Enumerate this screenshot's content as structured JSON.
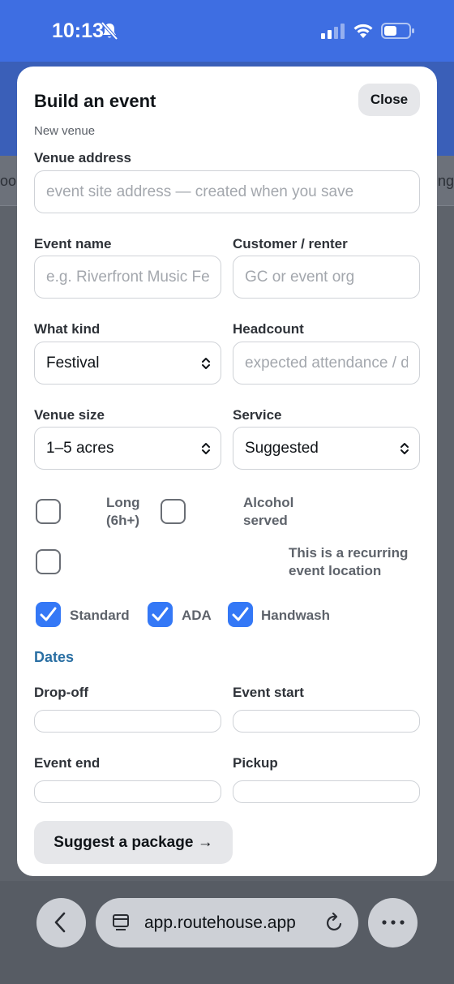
{
  "status_bar": {
    "time": "10:13"
  },
  "backdrop": {
    "tab_left": "oo",
    "tab_right": "ng"
  },
  "modal": {
    "title": "Build an event",
    "close_label": "Close",
    "subtitle": "New venue",
    "venue_address": {
      "label": "Venue address",
      "placeholder": "event site address — created when you save"
    },
    "event_name": {
      "label": "Event name",
      "placeholder": "e.g. Riverfront Music Festival"
    },
    "customer": {
      "label": "Customer / renter",
      "placeholder": "GC or event org"
    },
    "what_kind": {
      "label": "What kind",
      "value": "Festival"
    },
    "headcount": {
      "label": "Headcount",
      "placeholder": "expected attendance / day"
    },
    "venue_size": {
      "label": "Venue size",
      "value": "1–5 acres"
    },
    "service": {
      "label": "Service",
      "value": "Suggested"
    },
    "options": {
      "long_line1": "Long",
      "long_line2": "(6h+)",
      "alcohol_line1": "Alcohol",
      "alcohol_line2": "served",
      "recurring_line1": "This is a recurring",
      "recurring_line2": "event location",
      "long_checked": false,
      "alcohol_checked": false,
      "recurring_checked": false
    },
    "units": [
      {
        "label": "Standard",
        "checked": true
      },
      {
        "label": "ADA",
        "checked": true
      },
      {
        "label": "Handwash",
        "checked": true
      }
    ],
    "dates": {
      "title": "Dates",
      "dropoff_label": "Drop-off",
      "event_start_label": "Event start",
      "event_end_label": "Event end",
      "pickup_label": "Pickup"
    },
    "suggest_label": "Suggest a package →"
  },
  "browser": {
    "url": "app.routehouse.app"
  },
  "colors": {
    "accent": "#3478f6",
    "status_bar": "#3e6ee2",
    "section_title": "#2a6fa3"
  }
}
